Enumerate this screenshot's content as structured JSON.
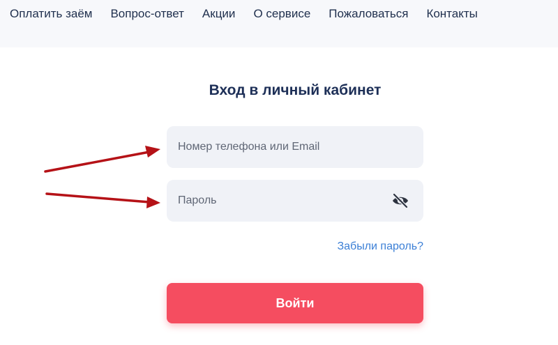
{
  "nav": {
    "items": [
      {
        "label": "Оплатить заём"
      },
      {
        "label": "Вопрос-ответ"
      },
      {
        "label": "Акции"
      },
      {
        "label": "О сервисе"
      },
      {
        "label": "Пожаловаться"
      },
      {
        "label": "Контакты"
      }
    ]
  },
  "login_form": {
    "title": "Вход в личный кабинет",
    "login_placeholder": "Номер телефона или Email",
    "password_placeholder": "Пароль",
    "forgot_label": "Забыли пароль?",
    "submit_label": "Войти"
  },
  "icons": {
    "password_toggle": "eye-off-icon",
    "annotation": "arrow-icon"
  },
  "colors": {
    "nav_text": "#1f2f4d",
    "title": "#1d2f57",
    "field_bg": "#f0f2f7",
    "link": "#3b7fd6",
    "submit_bg": "#f54d60",
    "arrow": "#b51217"
  }
}
